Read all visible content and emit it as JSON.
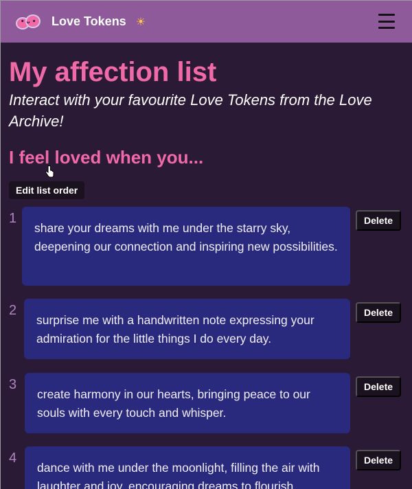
{
  "navbar": {
    "brand": "Love Tokens",
    "logo_icon": "love-tokens-logo",
    "theme_icon": "sun-icon",
    "menu_icon": "hamburger-menu-icon"
  },
  "page": {
    "title": "My affection list",
    "subtitle": "Interact with your favourite Love Tokens from the Love Archive!",
    "section_heading": "I feel loved when you...",
    "edit_button": "Edit list order"
  },
  "list": {
    "items": [
      {
        "number": "1",
        "text": "share your dreams with me under the starry sky, deepening our connection and inspiring new possibilities.",
        "delete_label": "Delete"
      },
      {
        "number": "2",
        "text": "surprise me with a handwritten note expressing your admiration for the little things I do every day.",
        "delete_label": "Delete"
      },
      {
        "number": "3",
        "text": "create harmony in our hearts, bringing peace to our souls with every touch and whisper.",
        "delete_label": "Delete"
      },
      {
        "number": "4",
        "text": "dance with me under the moonlight, filling the air with laughter and joy, encouraging dreams to flourish.",
        "delete_label": "Delete"
      }
    ]
  },
  "colors": {
    "navbar": "#8e5a9a",
    "background": "#2a1a35",
    "accent_pink": "#f06aa7",
    "card": "#29297d",
    "button": "#1a121f"
  }
}
